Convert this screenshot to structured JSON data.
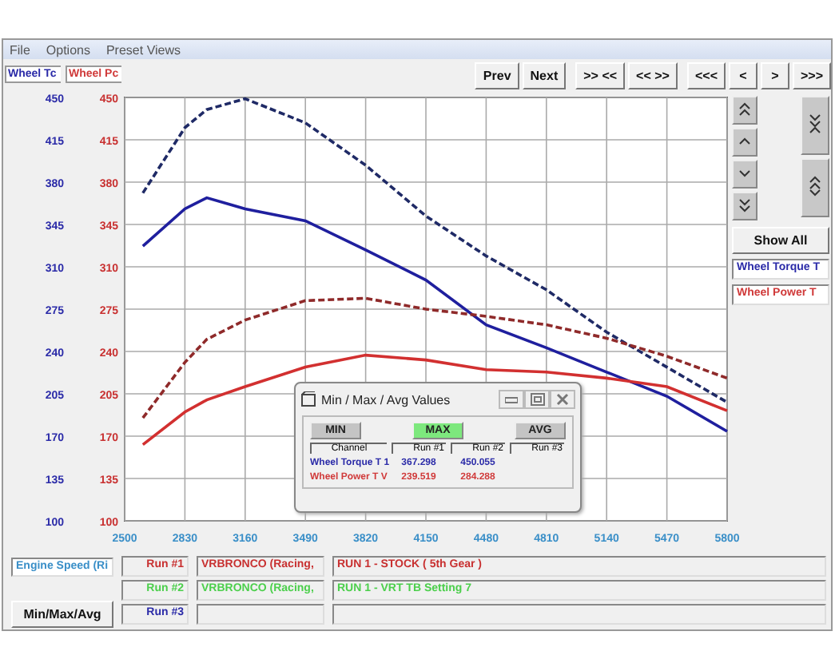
{
  "menu": [
    "File",
    "Options",
    "Preset Views"
  ],
  "legend_tabs": [
    {
      "label": "Wheel Tc",
      "color": "#2b2ba8"
    },
    {
      "label": "Wheel Pc",
      "color": "#d03a3a"
    }
  ],
  "nav_groups": [
    [
      "Prev",
      "Next"
    ],
    [
      ">> <<",
      "<< >>"
    ],
    [
      "<<<",
      "<",
      ">",
      ">>>"
    ]
  ],
  "left_axis": {
    "ticks": [
      "450",
      "415",
      "380",
      "345",
      "310",
      "275",
      "240",
      "205",
      "170",
      "135",
      "100"
    ]
  },
  "chart_data": {
    "type": "line",
    "grid": true,
    "xlim": [
      2500,
      5800
    ],
    "ylim": [
      100,
      450
    ],
    "x": [
      2600,
      2830,
      2950,
      3160,
      3490,
      3820,
      4150,
      4480,
      4810,
      5140,
      5470,
      5800
    ],
    "xticks": [
      2500,
      2830,
      3160,
      3490,
      3820,
      4150,
      4480,
      4810,
      5140,
      5470,
      5800
    ],
    "yticks": [
      450,
      415,
      380,
      345,
      310,
      275,
      240,
      205,
      170,
      135,
      100
    ],
    "series": [
      {
        "color": "#1f1f9e",
        "line_style": "solid",
        "values": [
          327,
          358,
          367,
          358,
          348,
          324,
          299,
          262,
          243,
          223,
          203,
          174
        ]
      },
      {
        "color": "#1f2a66",
        "line_style": "dashed",
        "values": [
          371,
          425,
          440,
          449,
          429,
          394,
          352,
          319,
          291,
          256,
          227,
          198
        ]
      },
      {
        "color": "#d23030",
        "line_style": "solid",
        "values": [
          163,
          190,
          200,
          211,
          227,
          237,
          233,
          225,
          223,
          218,
          211,
          191
        ]
      },
      {
        "color": "#8f2a2a",
        "line_style": "dashed",
        "values": [
          185,
          231,
          250,
          266,
          282,
          284,
          275,
          269,
          262,
          251,
          236,
          218
        ]
      }
    ]
  },
  "show_all": "Show All",
  "channels": [
    {
      "label": "Wheel Torque T",
      "color": "#2b2ba8"
    },
    {
      "label": "Wheel Power T",
      "color": "#d03a3a"
    }
  ],
  "x_channel": {
    "label": "Engine Speed (Ri",
    "color": "#3a8fc8"
  },
  "runs": [
    {
      "label": "Run #1",
      "color": "#c83030",
      "vehicle": "VRBRONCO (Racing,",
      "title": "RUN 1 - STOCK ( 5th Gear )"
    },
    {
      "label": "Run #2",
      "color": "#4ccf4c",
      "vehicle": "VRBRONCO (Racing,",
      "title": "RUN 1 - VRT TB Setting 7"
    },
    {
      "label": "Run #3",
      "color": "#2b2ba8"
    }
  ],
  "minmax_button": "Min/Max/Avg",
  "dialog": {
    "title": "Min / Max / Avg Values",
    "modes": [
      {
        "label": "MIN",
        "selected": false
      },
      {
        "label": "MAX",
        "selected": true
      },
      {
        "label": "AVG",
        "selected": false
      }
    ],
    "columns": [
      "Channel",
      "Run #1",
      "Run #2",
      "Run #3"
    ],
    "rows": [
      {
        "channel": "Wheel Torque T 1",
        "color": "#2b2ba8",
        "values": [
          "367.298",
          "450.055"
        ]
      },
      {
        "channel": "Wheel Power T V",
        "color": "#d03a3a",
        "values": [
          "239.519",
          "284.288"
        ]
      }
    ]
  }
}
